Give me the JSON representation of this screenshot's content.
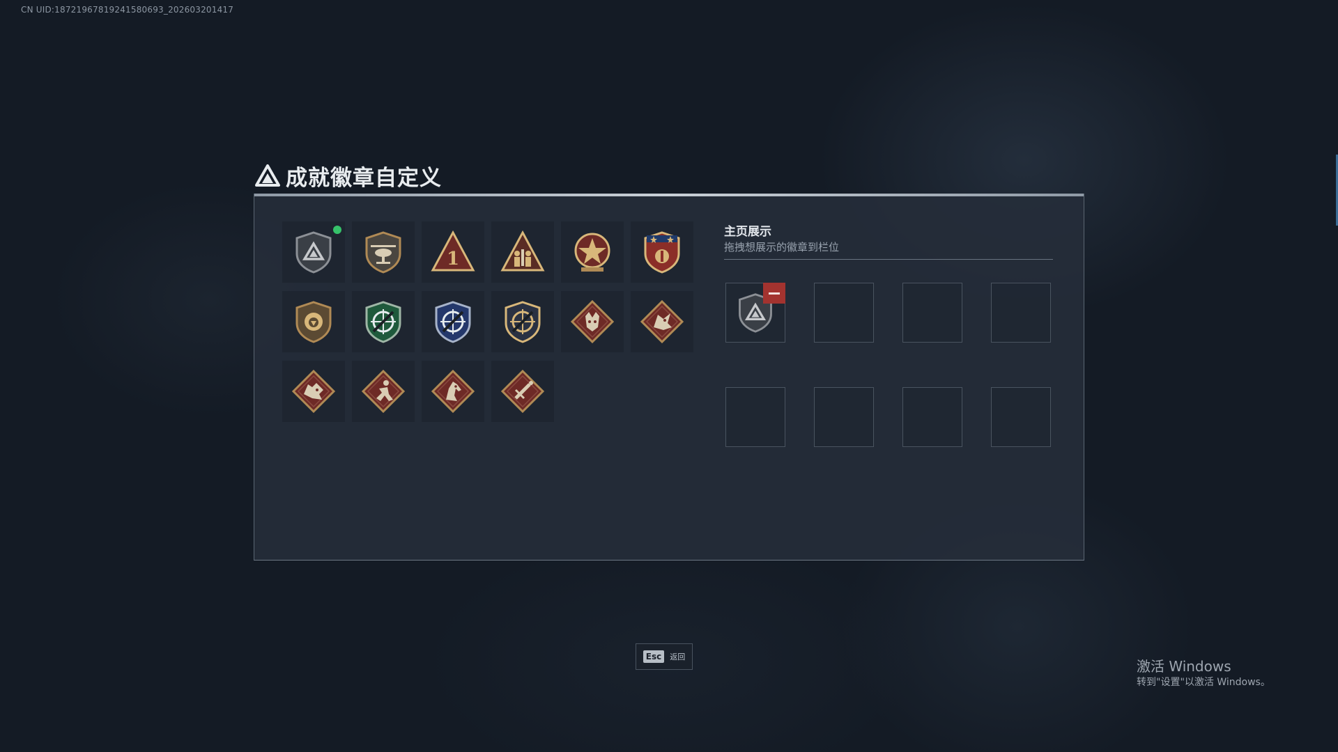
{
  "uid_text": "CN UID:18721967819241580693_202603201417",
  "title": "成就徽章自定义",
  "badges": [
    {
      "icon": "shield-triangle-badge-icon",
      "is_new": true
    },
    {
      "icon": "helicopter-shield-badge-icon",
      "is_new": false
    },
    {
      "icon": "triangle-number-one-badge-icon",
      "is_new": false
    },
    {
      "icon": "triangle-soldiers-badge-icon",
      "is_new": false
    },
    {
      "icon": "star-medal-badge-icon",
      "is_new": false
    },
    {
      "icon": "star-crest-badge-icon",
      "is_new": false
    },
    {
      "icon": "lion-shield-badge-icon",
      "is_new": false
    },
    {
      "icon": "green-crosshair-rifle-badge-icon",
      "is_new": false
    },
    {
      "icon": "blue-crosshair-rifle-badge-icon",
      "is_new": false
    },
    {
      "icon": "gold-crosshair-rifle-badge-icon",
      "is_new": false
    },
    {
      "icon": "wolf-diamond-badge-icon",
      "is_new": false
    },
    {
      "icon": "dragon-diamond-badge-icon",
      "is_new": false
    },
    {
      "icon": "dragon-head-diamond-badge-icon",
      "is_new": false
    },
    {
      "icon": "runner-diamond-badge-icon",
      "is_new": false
    },
    {
      "icon": "horse-diamond-badge-icon",
      "is_new": false
    },
    {
      "icon": "dagger-diamond-badge-icon",
      "is_new": false
    }
  ],
  "showcase": {
    "title": "主页展示",
    "hint": "拖拽想展示的徽章到栏位",
    "slots": [
      {
        "filled": true,
        "icon": "shield-triangle-badge-icon"
      },
      {
        "filled": false
      },
      {
        "filled": false
      },
      {
        "filled": false
      },
      {
        "filled": false
      },
      {
        "filled": false
      },
      {
        "filled": false
      },
      {
        "filled": false
      }
    ]
  },
  "back": {
    "key": "Esc",
    "label": "返回"
  },
  "activation": {
    "title": "激活 Windows",
    "subtitle": "转到\"设置\"以激活 Windows。"
  },
  "colors": {
    "accent_green": "#36c26a",
    "remove_red": "#a3332f",
    "bronze": "#b08a55",
    "maroon": "#6e2a26"
  }
}
